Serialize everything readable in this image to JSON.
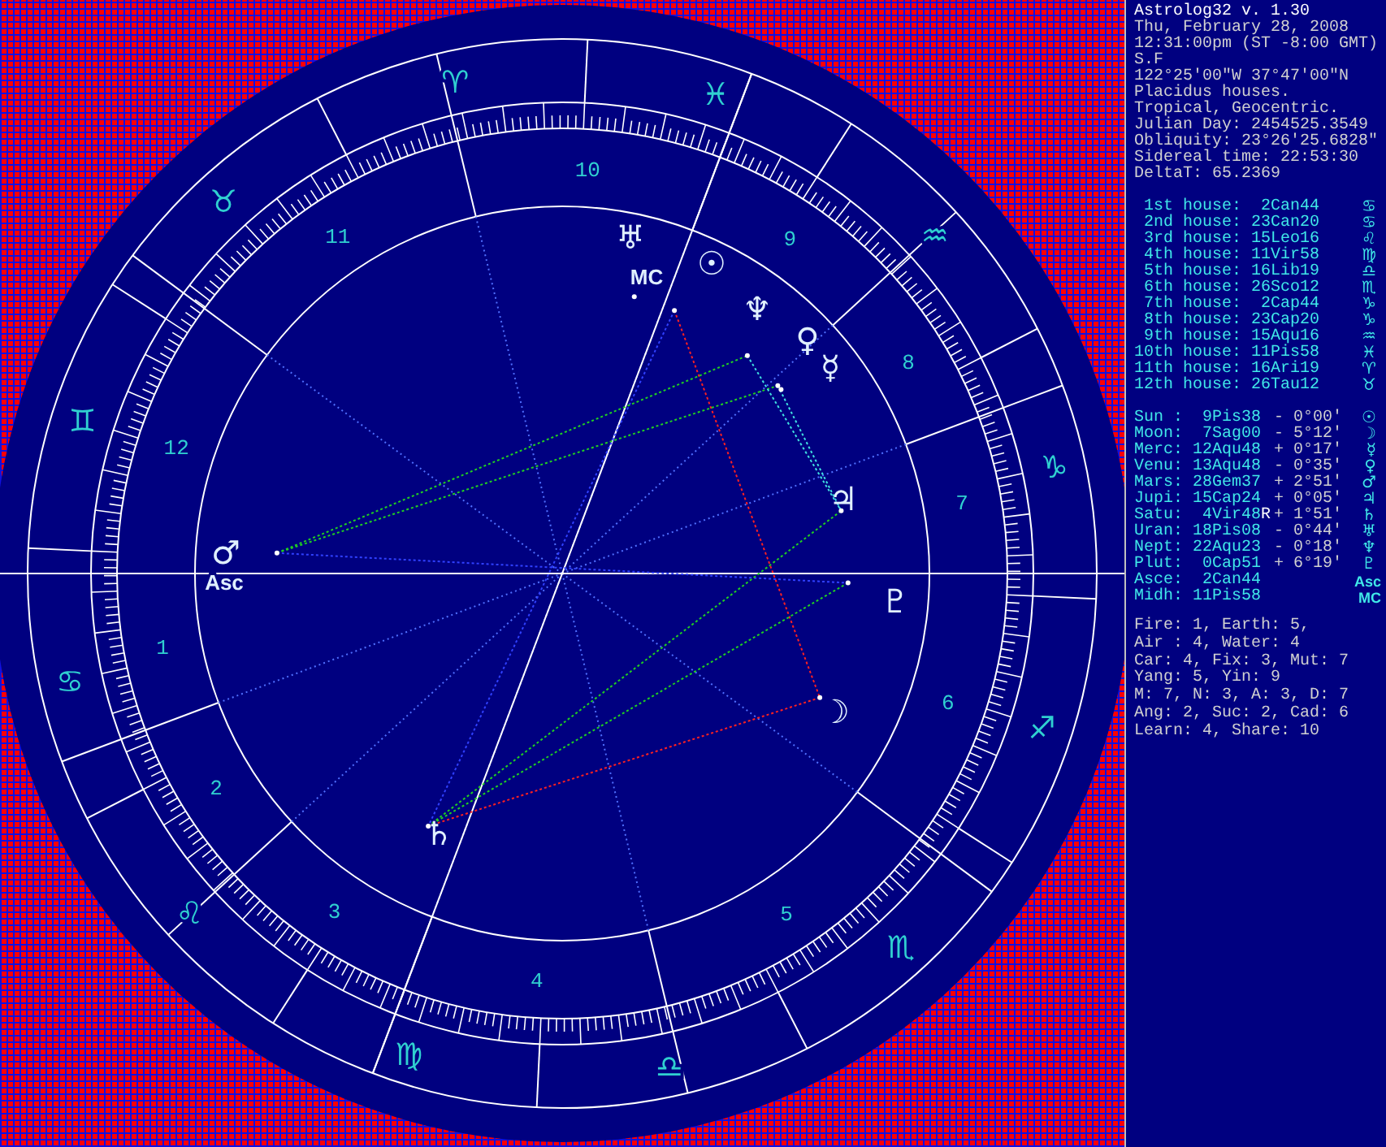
{
  "chart": {
    "signs": [
      "♈",
      "♉",
      "♊",
      "♋",
      "♌",
      "♍",
      "♎",
      "♏",
      "♐",
      "♑",
      "♒",
      "♓"
    ],
    "house_numbers": [
      "1",
      "2",
      "3",
      "4",
      "5",
      "6",
      "7",
      "8",
      "9",
      "10",
      "11",
      "12"
    ],
    "planets": [
      {
        "symbol": "☉"
      },
      {
        "symbol": "☽"
      },
      {
        "symbol": "☿"
      },
      {
        "symbol": "♀"
      },
      {
        "symbol": "♂"
      },
      {
        "symbol": "♃"
      },
      {
        "symbol": "♄"
      },
      {
        "symbol": "♅"
      },
      {
        "symbol": "♆"
      },
      {
        "symbol": "♇"
      }
    ],
    "angles": [
      {
        "label": "Asc"
      },
      {
        "label": "MC"
      }
    ]
  },
  "info": {
    "title": "Astrolog32 v. 1.30",
    "lines": [
      "Thu, February 28, 2008",
      "12:31:00pm (ST -8:00 GMT)",
      "S.F",
      "122°25'00\"W 37°47'00\"N",
      "Placidus houses.",
      "Tropical, Geocentric.",
      "Julian Day: 2454525.3549",
      "Obliquity: 23°26'25.6828\"",
      "Sidereal time: 22:53:30",
      "DeltaT:  65.2369"
    ]
  },
  "houses": [
    {
      "label": "1st house:",
      "cusp": "2Can44",
      "symbol": "♋"
    },
    {
      "label": "2nd house:",
      "cusp": "23Can20",
      "symbol": "♋"
    },
    {
      "label": "3rd house:",
      "cusp": "15Leo16",
      "symbol": "♌"
    },
    {
      "label": "4th house:",
      "cusp": "11Vir58",
      "symbol": "♍"
    },
    {
      "label": "5th house:",
      "cusp": "16Lib19",
      "symbol": "♎"
    },
    {
      "label": "6th house:",
      "cusp": "26Sco12",
      "symbol": "♏"
    },
    {
      "label": "7th house:",
      "cusp": "2Cap44",
      "symbol": "♑"
    },
    {
      "label": "8th house:",
      "cusp": "23Cap20",
      "symbol": "♑"
    },
    {
      "label": "9th house:",
      "cusp": "15Aqu16",
      "symbol": "♒"
    },
    {
      "label": "10th house:",
      "cusp": "11Pis58",
      "symbol": "♓"
    },
    {
      "label": "11th house:",
      "cusp": "16Ari19",
      "symbol": "♈"
    },
    {
      "label": "12th house:",
      "cusp": "26Tau12",
      "symbol": "♉"
    }
  ],
  "planets": [
    {
      "name": "Sun :",
      "position": "9Pis38",
      "deviation": "- 0°00'",
      "symbol": "☉"
    },
    {
      "name": "Moon:",
      "position": "7Sag00",
      "deviation": "- 5°12'",
      "symbol": "☽"
    },
    {
      "name": "Merc:",
      "position": "12Aqu48",
      "deviation": "+ 0°17'",
      "symbol": "☿"
    },
    {
      "name": "Venu:",
      "position": "13Aqu48",
      "deviation": "- 0°35'",
      "symbol": "♀"
    },
    {
      "name": "Mars:",
      "position": "28Gem37",
      "deviation": "+ 2°51'",
      "symbol": "♂"
    },
    {
      "name": "Jupi:",
      "position": "15Cap24",
      "deviation": "+ 0°05'",
      "symbol": "♃"
    },
    {
      "name": "Satu:",
      "position": "4Vir48",
      "flag": "R",
      "deviation": "+ 1°51'",
      "symbol": "♄"
    },
    {
      "name": "Uran:",
      "position": "18Pis08",
      "deviation": "- 0°44'",
      "symbol": "♅"
    },
    {
      "name": "Nept:",
      "position": "22Aqu23",
      "deviation": "- 0°18'",
      "symbol": "♆"
    },
    {
      "name": "Plut:",
      "position": "0Cap51",
      "deviation": "+ 6°19'",
      "symbol": "♇"
    },
    {
      "name": "Asce:",
      "position": "2Can44",
      "symbol": "Asc"
    },
    {
      "name": "Midh:",
      "position": "11Pis58",
      "symbol": "MC"
    }
  ],
  "summary": [
    "Fire: 1, Earth: 5,",
    "Air : 4, Water: 4",
    "Car: 4, Fix: 3, Mut: 7",
    "Yang: 5, Yin: 9",
    "M: 7, N: 3, A: 3, D: 7",
    "Ang: 2, Suc: 2, Cad: 6",
    "Learn: 4, Share: 10"
  ]
}
